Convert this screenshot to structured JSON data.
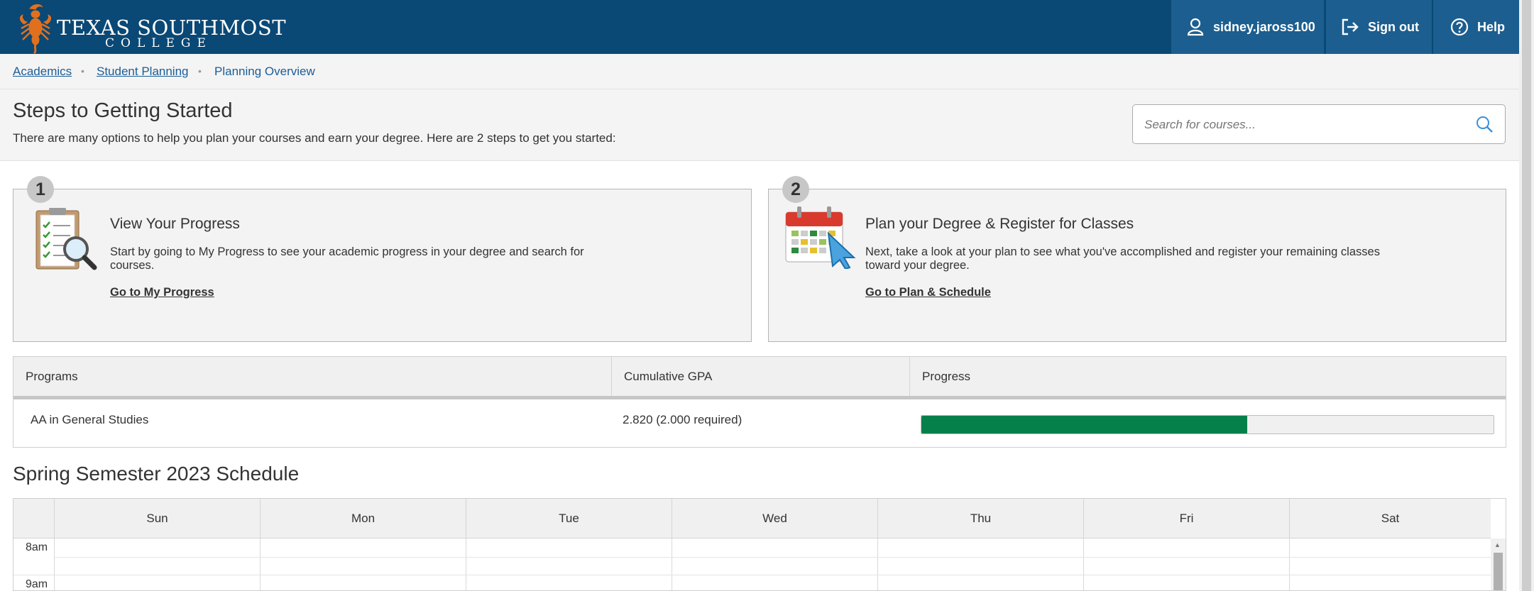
{
  "header": {
    "logo_line1": "TEXAS SOUTHMOST",
    "logo_line2": "COLLEGE",
    "user_label": "sidney.jaross100",
    "signout_label": "Sign out",
    "help_label": "Help",
    "bg_color": "#0a4875"
  },
  "breadcrumb": {
    "items": [
      "Academics",
      "Student Planning",
      "Planning Overview"
    ]
  },
  "intro": {
    "title": "Steps to Getting Started",
    "subtitle": "There are many options to help you plan your courses and earn your degree. Here are 2 steps to get you started:"
  },
  "search": {
    "placeholder": "Search for courses..."
  },
  "steps": [
    {
      "number": "1",
      "title": "View Your Progress",
      "text": "Start by going to My Progress to see your academic progress in your degree and search for courses.",
      "link": "Go to My Progress",
      "icon": "clipboard-magnifier-icon"
    },
    {
      "number": "2",
      "title": "Plan your Degree & Register for Classes",
      "text": "Next, take a look at your plan to see what you've accomplished and register your remaining classes toward your degree.",
      "link": "Go to Plan & Schedule",
      "icon": "calendar-cursor-icon"
    }
  ],
  "programs": {
    "columns": [
      "Programs",
      "Cumulative GPA",
      "Progress"
    ],
    "rows": [
      {
        "program": "AA in General Studies",
        "gpa": "2.820 (2.000 required)",
        "progress_percent": 57,
        "progress_color": "#06804a"
      }
    ]
  },
  "schedule": {
    "title": "Spring Semester 2023 Schedule",
    "days": [
      "Sun",
      "Mon",
      "Tue",
      "Wed",
      "Thu",
      "Fri",
      "Sat"
    ],
    "times": [
      "8am",
      "9am"
    ]
  }
}
